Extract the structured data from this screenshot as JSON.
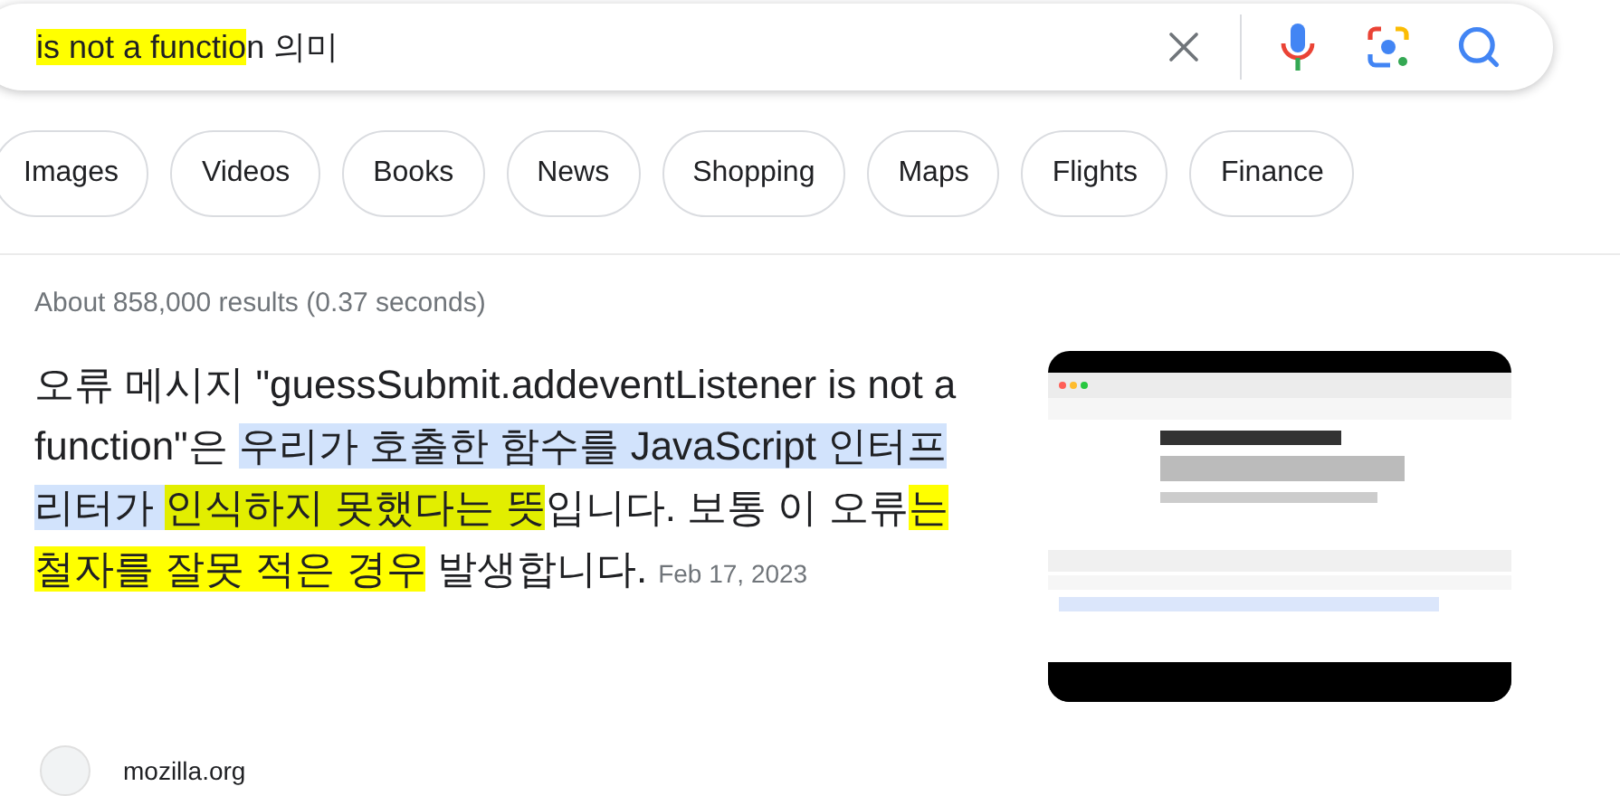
{
  "search": {
    "query": [
      {
        "text": "is not a functio",
        "marked": true
      },
      {
        "text": "n 의미",
        "marked": false
      }
    ]
  },
  "chips": [
    {
      "label": "Images"
    },
    {
      "label": "Videos"
    },
    {
      "label": "Books"
    },
    {
      "label": "News"
    },
    {
      "label": "Shopping"
    },
    {
      "label": "Maps"
    },
    {
      "label": "Flights"
    },
    {
      "label": "Finance"
    }
  ],
  "result_stats": "About 858,000 results (0.37 seconds)",
  "snippet": {
    "segments": [
      {
        "text": "오류 메시지 \"guessSubmit.addeventListener is not a function\"은 ",
        "highlighted": false,
        "marked": false
      },
      {
        "text": "우리가 호출한 함수를 JavaScript 인터프리터가 ",
        "highlighted": true,
        "marked": false
      },
      {
        "text": "인식하지 못했다는 뜻",
        "highlighted": true,
        "marked": true
      },
      {
        "text": "입니다. 보통 이 오류",
        "highlighted": false,
        "marked": false
      },
      {
        "text": "는 철자를 잘못 적은 경우",
        "highlighted": false,
        "marked": true
      },
      {
        "text": " 발생합니다.",
        "highlighted": false,
        "marked": false
      }
    ],
    "date": "Feb 17, 2023"
  },
  "source": {
    "site": "mozilla.org"
  }
}
